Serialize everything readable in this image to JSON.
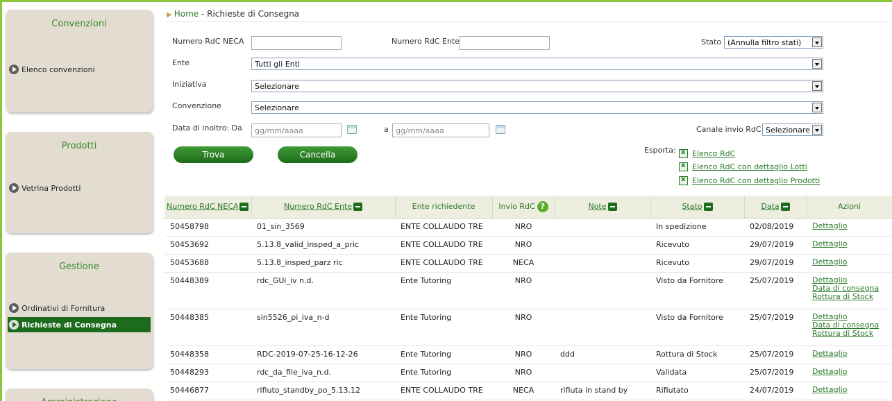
{
  "sidebar": {
    "convenzioni": {
      "title": "Convenzioni",
      "items": [
        "Elenco convenzioni"
      ]
    },
    "prodotti": {
      "title": "Prodotti",
      "items": [
        "Vetrina Prodotti"
      ]
    },
    "gestione": {
      "title": "Gestione",
      "items": [
        "Ordinativi di Fornitura",
        "Richieste di Consegna"
      ]
    },
    "amministrazione": {
      "title": "Amministrazione"
    }
  },
  "breadcrumb": {
    "home": "Home",
    "separator": " - ",
    "current": "Richieste di Consegna"
  },
  "filters": {
    "numero_rdc_neca_label": "Numero RdC NECA",
    "numero_rdc_neca_value": "",
    "numero_rdc_ente_label": "Numero RdC Ente",
    "numero_rdc_ente_value": "",
    "stato_label": "Stato",
    "stato_value": "(Annulla filtro stati)",
    "ente_label": "Ente",
    "ente_value": "Tutti gli Enti",
    "iniziativa_label": "Iniziativa",
    "iniziativa_value": "Selezionare",
    "convenzione_label": "Convenzione",
    "convenzione_value": "Selezionare",
    "data_da_label": "Data di inoltro: Da",
    "data_da_placeholder": "gg/mm/aaaa",
    "data_a_label": "a",
    "data_a_placeholder": "gg/mm/aaaa",
    "canale_label": "Canale invio RdC",
    "canale_value": "Selezionare"
  },
  "buttons": {
    "trova": "Trova",
    "cancella": "Cancella"
  },
  "export": {
    "label": "Esporta:",
    "links": [
      "Elenco RdC",
      "Elenco RdC con dettaglio Lotti",
      "Elenco RdC con dettaglio Prodotti"
    ]
  },
  "table": {
    "headers": [
      "Numero RdC NECA",
      "Numero RdC Ente",
      "Ente richiedente",
      "Invio RdC",
      "Note",
      "Stato",
      "Data",
      "Azioni"
    ],
    "rows": [
      {
        "neca": "50458798",
        "ente_num": "01_sin_3569",
        "ente": "ENTE COLLAUDO TRE",
        "invio": "NRO",
        "note": "",
        "stato": "In spedizione",
        "data": "02/08/2019",
        "azioni": [
          "Dettaglio"
        ]
      },
      {
        "neca": "50453692",
        "ente_num": "5.13.8_valid_insped_a_pric",
        "ente": "ENTE COLLAUDO TRE",
        "invio": "NRO",
        "note": "",
        "stato": "Ricevuto",
        "data": "29/07/2019",
        "azioni": [
          "Dettaglio"
        ]
      },
      {
        "neca": "50453688",
        "ente_num": "5.13.8_insped_parz ric",
        "ente": "ENTE COLLAUDO TRE",
        "invio": "NECA",
        "note": "",
        "stato": "Ricevuto",
        "data": "29/07/2019",
        "azioni": [
          "Dettaglio"
        ]
      },
      {
        "neca": "50448389",
        "ente_num": "rdc_GUi_iv n.d.",
        "ente": "Ente Tutoring",
        "invio": "NRO",
        "note": "",
        "stato": "Visto da Fornitore",
        "data": "25/07/2019",
        "azioni": [
          "Dettaglio",
          "Data di consegna",
          "Rottura di Stock"
        ]
      },
      {
        "neca": "50448385",
        "ente_num": "sin5526_pi_iva_n-d",
        "ente": "Ente Tutoring",
        "invio": "NRO",
        "note": "",
        "stato": "Visto da Fornitore",
        "data": "25/07/2019",
        "azioni": [
          "Dettaglio",
          "Data di consegna",
          "Rottura di Stock"
        ]
      },
      {
        "neca": "50448358",
        "ente_num": "RDC-2019-07-25-16-12-26",
        "ente": "Ente Tutoring",
        "invio": "NRO",
        "note": "ddd",
        "stato": "Rottura di Stock",
        "data": "25/07/2019",
        "azioni": [
          "Dettaglio"
        ]
      },
      {
        "neca": "50448293",
        "ente_num": "rdc_da_file_iva_n.d.",
        "ente": "Ente Tutoring",
        "invio": "NRO",
        "note": "",
        "stato": "Validata",
        "data": "25/07/2019",
        "azioni": [
          "Dettaglio"
        ]
      },
      {
        "neca": "50446877",
        "ente_num": "rifiuto_standby_po_5.13.12",
        "ente": "ENTE COLLAUDO TRE",
        "invio": "NECA",
        "note": "rifiuta in stand by",
        "stato": "Rifiutato",
        "data": "24/07/2019",
        "azioni": [
          "Dettaglio"
        ]
      }
    ]
  },
  "colors": {
    "accent_green": "#1d6b1d",
    "link_green": "#2a7a2a",
    "sidebar_bg": "#e2ddd0",
    "header_bg": "#eeeee0"
  }
}
